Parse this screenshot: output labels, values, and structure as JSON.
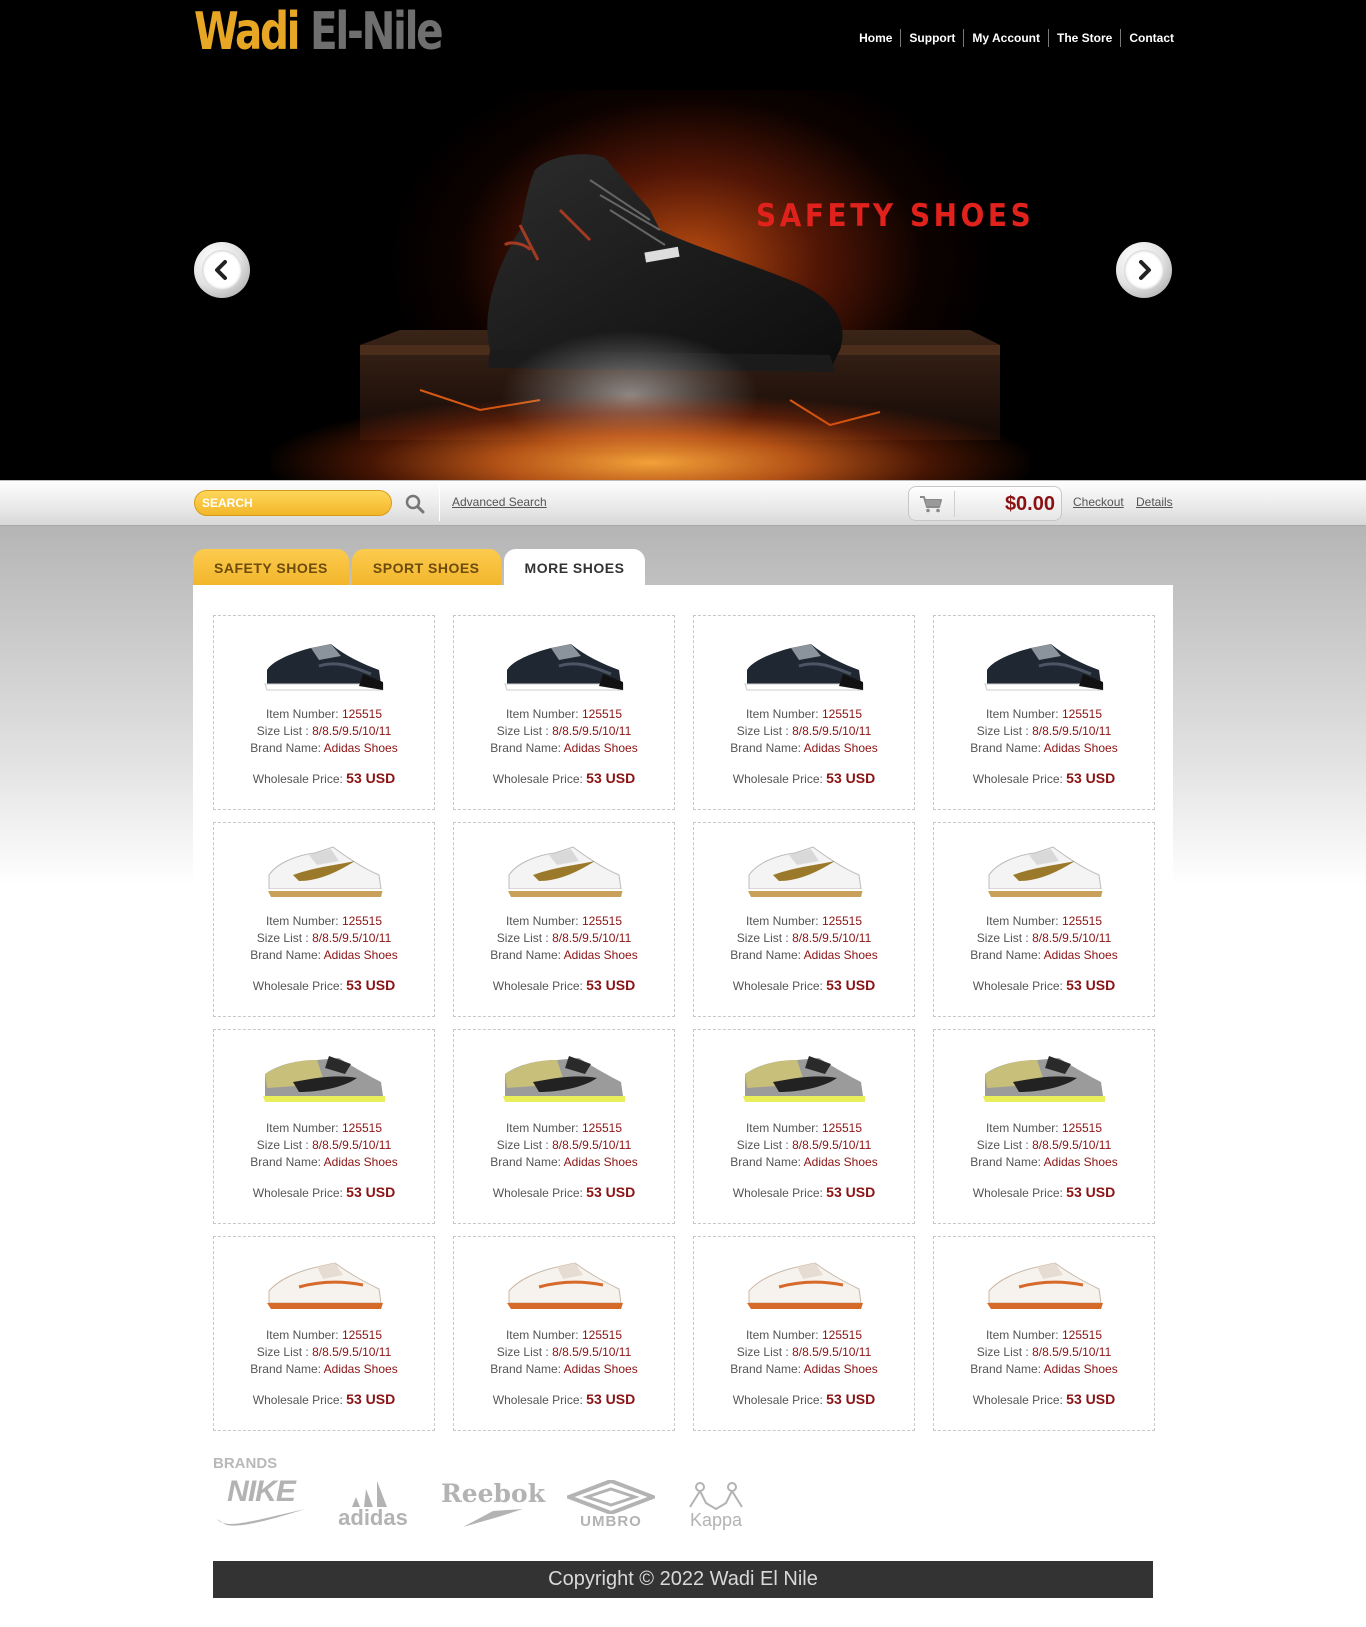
{
  "header": {
    "logo_word1": "Wadi",
    "logo_word2": "El-Nile",
    "nav": [
      "Home",
      "Support",
      "My Account",
      "The Store",
      "Contact"
    ]
  },
  "hero": {
    "title": "SAFETY SHOES",
    "prev_icon": "chevron-left-icon",
    "next_icon": "chevron-right-icon"
  },
  "toolbar": {
    "search_placeholder": "SEARCH",
    "search_icon": "magnifier-icon",
    "advanced_search": "Advanced Search",
    "cart_icon": "cart-icon",
    "cart_total": "$0.00",
    "checkout": "Checkout",
    "details": "Details"
  },
  "tabs": [
    {
      "label": "SAFETY SHOES",
      "active": false
    },
    {
      "label": "SPORT SHOES",
      "active": false
    },
    {
      "label": "MORE SHOES",
      "active": true
    }
  ],
  "labels": {
    "item_number": "Item Number: ",
    "size_list": "Size List : ",
    "brand_name": "Brand Name: ",
    "wholesale_price": "Wholesale Price: "
  },
  "products": [
    {
      "item_number": "125515",
      "size_list": "8/8.5/9.5/10/11",
      "brand": "Adidas Shoes",
      "price": "53 USD",
      "image": "dark-low-sneaker"
    },
    {
      "item_number": "125515",
      "size_list": "8/8.5/9.5/10/11",
      "brand": "Adidas Shoes",
      "price": "53 USD",
      "image": "dark-low-sneaker"
    },
    {
      "item_number": "125515",
      "size_list": "8/8.5/9.5/10/11",
      "brand": "Adidas Shoes",
      "price": "53 USD",
      "image": "dark-low-sneaker"
    },
    {
      "item_number": "125515",
      "size_list": "8/8.5/9.5/10/11",
      "brand": "Adidas Shoes",
      "price": "53 USD",
      "image": "dark-low-sneaker"
    },
    {
      "item_number": "125515",
      "size_list": "8/8.5/9.5/10/11",
      "brand": "Adidas Shoes",
      "price": "53 USD",
      "image": "white-gold-trainer"
    },
    {
      "item_number": "125515",
      "size_list": "8/8.5/9.5/10/11",
      "brand": "Adidas Shoes",
      "price": "53 USD",
      "image": "white-gold-trainer"
    },
    {
      "item_number": "125515",
      "size_list": "8/8.5/9.5/10/11",
      "brand": "Adidas Shoes",
      "price": "53 USD",
      "image": "white-gold-trainer"
    },
    {
      "item_number": "125515",
      "size_list": "8/8.5/9.5/10/11",
      "brand": "Adidas Shoes",
      "price": "53 USD",
      "image": "white-gold-trainer"
    },
    {
      "item_number": "125515",
      "size_list": "8/8.5/9.5/10/11",
      "brand": "Adidas Shoes",
      "price": "53 USD",
      "image": "yellow-grey-dunk"
    },
    {
      "item_number": "125515",
      "size_list": "8/8.5/9.5/10/11",
      "brand": "Adidas Shoes",
      "price": "53 USD",
      "image": "yellow-grey-dunk"
    },
    {
      "item_number": "125515",
      "size_list": "8/8.5/9.5/10/11",
      "brand": "Adidas Shoes",
      "price": "53 USD",
      "image": "yellow-grey-dunk"
    },
    {
      "item_number": "125515",
      "size_list": "8/8.5/9.5/10/11",
      "brand": "Adidas Shoes",
      "price": "53 USD",
      "image": "yellow-grey-dunk"
    },
    {
      "item_number": "125515",
      "size_list": "8/8.5/9.5/10/11",
      "brand": "Adidas Shoes",
      "price": "53 USD",
      "image": "white-orange-runner"
    },
    {
      "item_number": "125515",
      "size_list": "8/8.5/9.5/10/11",
      "brand": "Adidas Shoes",
      "price": "53 USD",
      "image": "white-orange-runner"
    },
    {
      "item_number": "125515",
      "size_list": "8/8.5/9.5/10/11",
      "brand": "Adidas Shoes",
      "price": "53 USD",
      "image": "white-orange-runner"
    },
    {
      "item_number": "125515",
      "size_list": "8/8.5/9.5/10/11",
      "brand": "Adidas Shoes",
      "price": "53 USD",
      "image": "white-orange-runner"
    }
  ],
  "brands": {
    "title": "BRANDS",
    "logos": [
      "NIKE",
      "adidas",
      "Reebok",
      "UMBRO",
      "Kappa"
    ]
  },
  "footer": {
    "copyright": "Copyright © 2022 Wadi El Nile"
  },
  "colors": {
    "accent_yellow": "#f2b52b",
    "price_red": "#8b1212",
    "hero_title_red": "#e0211c",
    "footer_bg": "#333333"
  }
}
